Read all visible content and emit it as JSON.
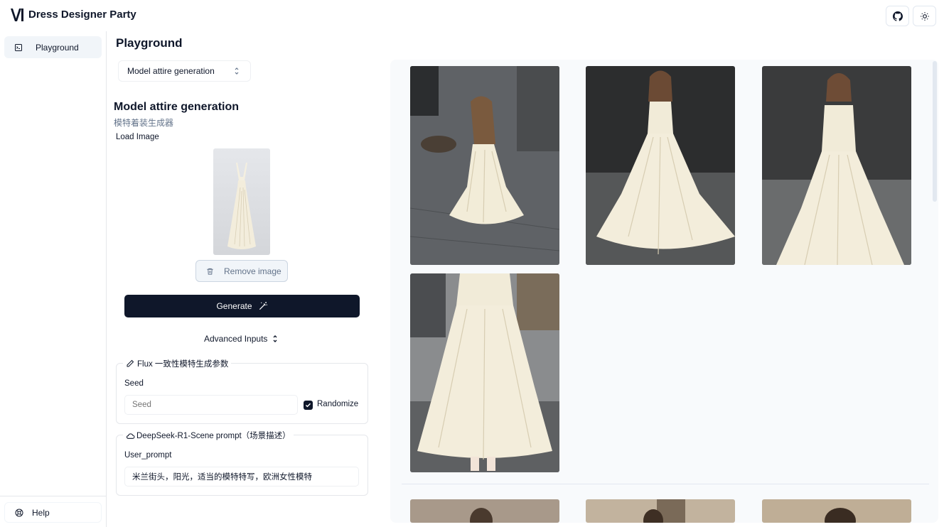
{
  "app": {
    "title": "Dress Designer Party"
  },
  "sidebar": {
    "items": [
      {
        "label": "Playground",
        "icon": "terminal-square-icon"
      }
    ],
    "footer": {
      "label": "Help",
      "icon": "lifebuoy-icon"
    }
  },
  "main": {
    "title": "Playground",
    "mode_select": {
      "value": "Model attire generation"
    },
    "section": {
      "title": "Model attire generation",
      "subtitle": "模特着装生成器",
      "load_label": "Load Image",
      "remove_label": "Remove image",
      "generate_label": "Generate",
      "advanced_label": "Advanced Inputs"
    },
    "flux_group": {
      "legend": "Flux 一致性模特生成参数",
      "seed_label": "Seed",
      "seed_placeholder": "Seed",
      "randomize_label": "Randomize",
      "randomize_checked": true
    },
    "deepseek_group": {
      "legend": "DeepSeek-R1-Scene prompt（场景描述）",
      "user_prompt_label": "User_prompt",
      "user_prompt_value": "米兰街头，阳光，适当的模特特写，欧洲女性模特"
    }
  },
  "gallery": {
    "images": [
      "dress-photo-1",
      "dress-photo-2",
      "dress-photo-3",
      "dress-photo-4",
      "dress-photo-5",
      "dress-photo-6",
      "dress-photo-7"
    ]
  },
  "colors": {
    "primary": "#0f172a",
    "muted": "#64748b",
    "border": "#e2e8f0",
    "gallery_bg": "#f8fafc"
  }
}
